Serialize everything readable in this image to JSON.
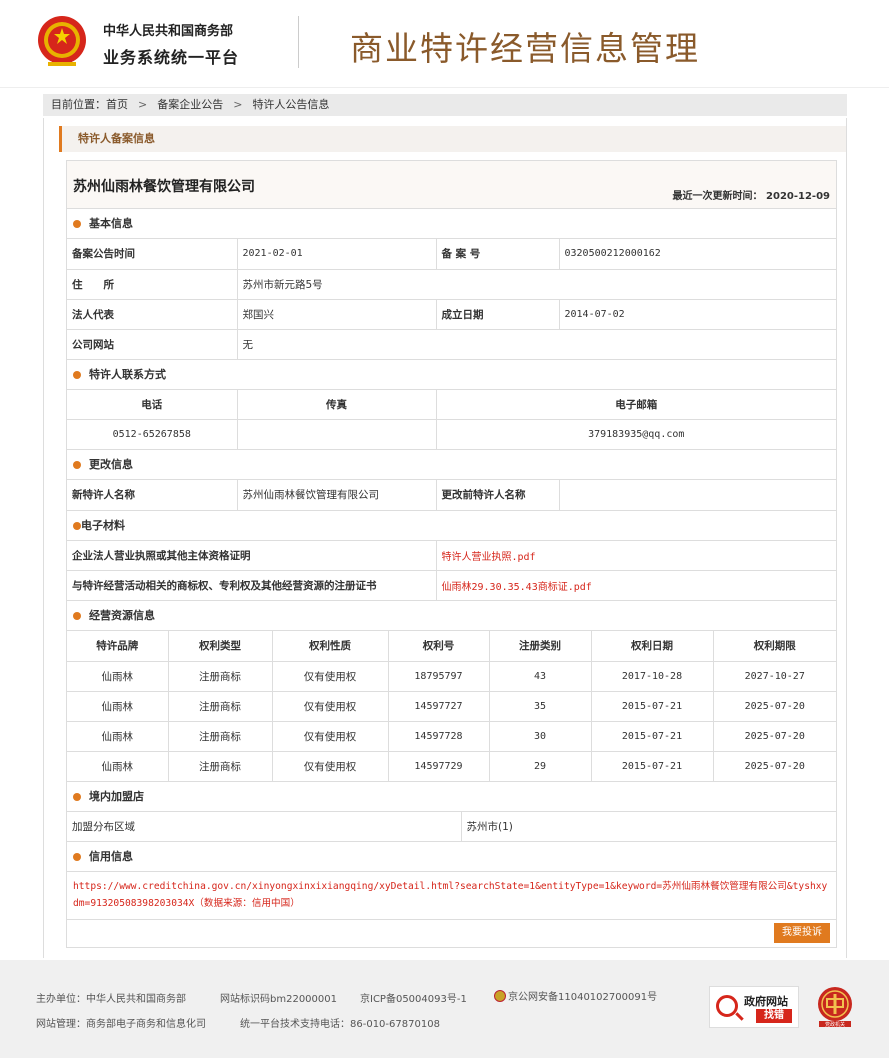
{
  "header": {
    "gov_name": "中华人民共和国商务部",
    "gov_sub": "业务系统统一平台",
    "title": "商业特许经营信息管理"
  },
  "breadcrumb": {
    "prefix": "目前位置：",
    "items": [
      "首页",
      "备案企业公告",
      "特许人公告信息"
    ],
    "sep": ">"
  },
  "section_title": "特许人备案信息",
  "company": {
    "name": "苏州仙雨林餐饮管理有限公司",
    "update_label": "最近一次更新时间：",
    "update_date": "2020-12-09"
  },
  "basic": {
    "title": "基本信息",
    "announce_time_label": "备案公告时间",
    "announce_time": "2021-02-01",
    "record_no_label": "备 案 号",
    "record_no": "0320500212000162",
    "address_label": "住　　所",
    "address": "苏州市新元路5号",
    "legal_rep_label": "法人代表",
    "legal_rep": "郑国兴",
    "found_date_label": "成立日期",
    "found_date": "2014-07-02",
    "website_label": "公司网站",
    "website": "无"
  },
  "contact": {
    "title": "特许人联系方式",
    "phone_label": "电话",
    "fax_label": "传真",
    "email_label": "电子邮箱",
    "phone": "0512-65267858",
    "fax": "",
    "email": "379183935@qq.com"
  },
  "change": {
    "title": "更改信息",
    "new_name_label": "新特许人名称",
    "new_name": "苏州仙雨林餐饮管理有限公司",
    "old_name_label": "更改前特许人名称",
    "old_name": ""
  },
  "materials": {
    "title": "电子材料",
    "items": [
      {
        "label": "企业法人营业执照或其他主体资格证明",
        "file": "特许人营业执照.pdf"
      },
      {
        "label": "与特许经营活动相关的商标权、专利权及其他经营资源的注册证书",
        "file": "仙雨林29.30.35.43商标证.pdf"
      }
    ]
  },
  "resources": {
    "title": "经营资源信息",
    "columns": [
      "特许品牌",
      "权利类型",
      "权利性质",
      "权利号",
      "注册类别",
      "权利日期",
      "权利期限"
    ],
    "rows": [
      [
        "仙雨林",
        "注册商标",
        "仅有使用权",
        "18795797",
        "43",
        "2017-10-28",
        "2027-10-27"
      ],
      [
        "仙雨林",
        "注册商标",
        "仅有使用权",
        "14597727",
        "35",
        "2015-07-21",
        "2025-07-20"
      ],
      [
        "仙雨林",
        "注册商标",
        "仅有使用权",
        "14597728",
        "30",
        "2015-07-21",
        "2025-07-20"
      ],
      [
        "仙雨林",
        "注册商标",
        "仅有使用权",
        "14597729",
        "29",
        "2015-07-21",
        "2025-07-20"
      ]
    ]
  },
  "franchise": {
    "title": "境内加盟店",
    "area_label": "加盟分布区域",
    "area": "苏州市(1)"
  },
  "credit": {
    "title": "信用信息",
    "url": "https://www.creditchina.gov.cn/xinyongxinxixiangqing/xyDetail.html?searchState=1&entityType=1&keyword=苏州仙雨林餐饮管理有限公司&tyshxydm=91320508398203034X（数据来源：信用中国）",
    "complain_label": "我要投诉"
  },
  "footer": {
    "host": "主办单位：中华人民共和国商务部",
    "site_code": "网站标识码bm22000001",
    "icp": "京ICP备05004093号-1",
    "police": "京公网安备11040102700091号",
    "manage": "网站管理：商务部电子商务和信息化司",
    "support": "统一平台技术支持电话：86-010-67870108",
    "badge1_title": "政府网站",
    "badge1_sub": "找错",
    "badge2": "党政机关"
  },
  "colors": {
    "accent": "#e07a1f",
    "title_brown": "#8a5a2b",
    "link_red": "#d6261b"
  }
}
